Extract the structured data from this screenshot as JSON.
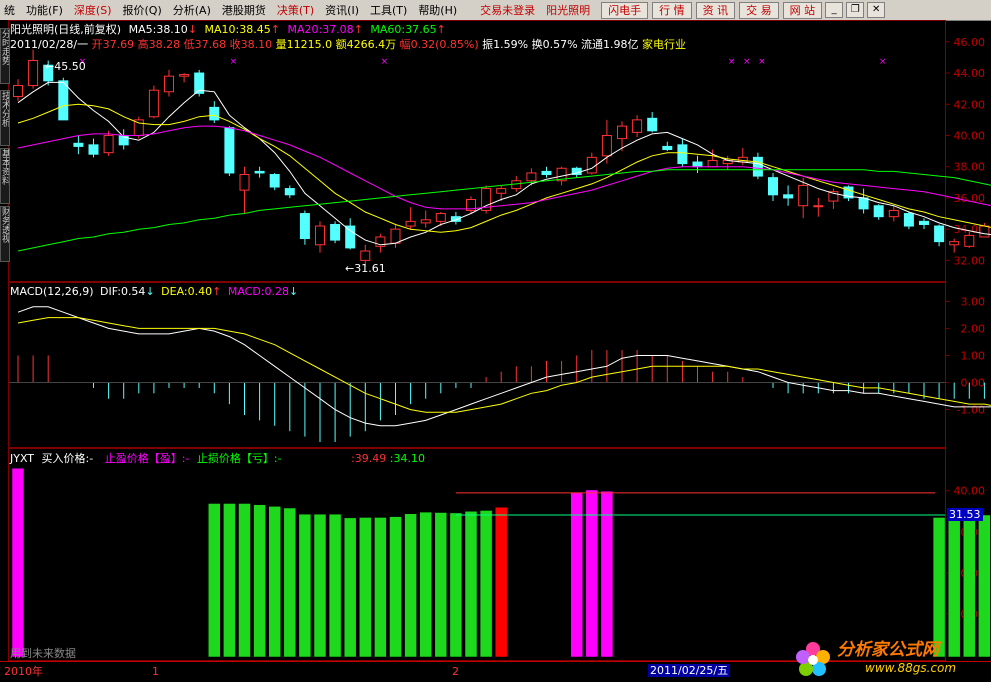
{
  "menu": [
    "统",
    "功能",
    "深度",
    "报价",
    "分析",
    "港股期货",
    "决策",
    "资讯",
    "工具",
    "帮助"
  ],
  "menu_hotkeys": [
    "",
    "(F)",
    "(S)",
    "(Q)",
    "(A)",
    "",
    "(T)",
    "(I)",
    "(T)",
    "(H)"
  ],
  "login_status": "交易未登录",
  "stock_name_menu": "阳光照明",
  "system_buttons": [
    "闪电手",
    "行  情",
    "资  讯",
    "交  易",
    "网  站"
  ],
  "left_tabs": [
    "分时走势",
    "技术分析",
    "基本资料",
    "财务透视"
  ],
  "header": {
    "stock_line": "阳光照明(日线,前复权)",
    "ma5": "MA5:38.10",
    "ma10": "MA10:38.45",
    "ma20": "MA20:37.08",
    "ma60": "MA60:37.65",
    "date": "2011/02/28/一",
    "open": "开37.69",
    "high": "高38.28",
    "low": "低37.68",
    "close": "收38.10",
    "volume": "量11215.0",
    "amount": "额4266.4万",
    "change": "幅0.32(0.85%)",
    "amplitude": "振1.59%",
    "turnover": "换0.57%",
    "float": "流通1.98亿",
    "industry": "家电行业"
  },
  "annotations": {
    "high_mark": "45.50",
    "low_mark": "31.61"
  },
  "macd_header": {
    "name": "MACD(12,26,9)",
    "dif": "DIF:0.54",
    "dea": "DEA:0.40",
    "macd": "MACD:0.28"
  },
  "jyxt_header": {
    "name": "JYXT",
    "buy": "买入价格:-",
    "tp": "止盈价格【盈】:-",
    "sl": "止损价格【亏】:-",
    "v1": ":39.49",
    "v2": ":34.10"
  },
  "jyxt_current": "31.53",
  "jyxt_note": "用到未来数据",
  "time_axis": {
    "year": "2010年",
    "m1": "1",
    "m2": "2",
    "cursor": "2011/02/25/五"
  },
  "logo": {
    "cn": "分析家公式网",
    "url": "www.88gs.com"
  },
  "colors": {
    "up": "#ff3232",
    "down": "#54ffff",
    "ma5": "#ffffff",
    "ma10": "#ffff00",
    "ma20": "#ff00ff",
    "ma60": "#00ff00",
    "grid": "#800000"
  },
  "chart_data": [
    {
      "type": "candlestick",
      "title": "阳光照明(日线,前复权)",
      "ylim": [
        31,
        46.5
      ],
      "yticks": [
        32,
        34,
        36,
        38,
        40,
        42,
        44,
        46
      ],
      "candles": [
        [
          42.5,
          43.6,
          42.2,
          43.2
        ],
        [
          43.2,
          45.5,
          43.0,
          44.8
        ],
        [
          44.5,
          44.8,
          43.2,
          43.5
        ],
        [
          43.5,
          43.7,
          41.0,
          41.0
        ],
        [
          39.5,
          40.0,
          38.8,
          39.3
        ],
        [
          39.4,
          39.8,
          38.6,
          38.8
        ],
        [
          38.9,
          40.3,
          38.7,
          40.0
        ],
        [
          40.0,
          40.4,
          39.1,
          39.4
        ],
        [
          40.0,
          41.2,
          39.8,
          41.0
        ],
        [
          41.2,
          43.2,
          41.1,
          42.9
        ],
        [
          42.8,
          44.2,
          42.5,
          43.8
        ],
        [
          43.8,
          44.0,
          43.4,
          43.9
        ],
        [
          44.0,
          44.2,
          42.5,
          42.7
        ],
        [
          41.8,
          42.2,
          40.8,
          41.0
        ],
        [
          40.5,
          40.6,
          37.4,
          37.6
        ],
        [
          36.5,
          38.0,
          35.0,
          37.5
        ],
        [
          37.7,
          38.0,
          37.3,
          37.6
        ],
        [
          37.5,
          37.6,
          36.5,
          36.7
        ],
        [
          36.6,
          36.8,
          36.0,
          36.2
        ],
        [
          35.0,
          35.2,
          33.0,
          33.4
        ],
        [
          33.0,
          34.5,
          32.5,
          34.2
        ],
        [
          34.3,
          34.5,
          33.1,
          33.3
        ],
        [
          34.2,
          34.7,
          32.7,
          32.8
        ],
        [
          32.0,
          33.0,
          31.6,
          32.6
        ],
        [
          32.9,
          33.7,
          32.5,
          33.5
        ],
        [
          33.1,
          34.3,
          32.8,
          34.0
        ],
        [
          34.2,
          35.4,
          34.0,
          34.5
        ],
        [
          34.4,
          35.2,
          34.1,
          34.6
        ],
        [
          34.5,
          35.1,
          34.2,
          35.0
        ],
        [
          34.8,
          35.1,
          34.3,
          34.5
        ],
        [
          35.2,
          36.1,
          35.0,
          35.9
        ],
        [
          35.2,
          36.8,
          35.0,
          36.6
        ],
        [
          36.3,
          36.8,
          35.8,
          36.6
        ],
        [
          36.6,
          37.4,
          36.4,
          37.1
        ],
        [
          37.1,
          37.9,
          36.8,
          37.6
        ],
        [
          37.7,
          38.0,
          37.3,
          37.5
        ],
        [
          37.1,
          38.0,
          36.8,
          37.9
        ],
        [
          37.9,
          38.0,
          37.3,
          37.5
        ],
        [
          37.6,
          38.9,
          37.5,
          38.6
        ],
        [
          38.7,
          41.0,
          38.2,
          40.0
        ],
        [
          39.8,
          40.9,
          39.0,
          40.6
        ],
        [
          40.2,
          41.3,
          39.9,
          41.0
        ],
        [
          41.1,
          41.5,
          40.2,
          40.3
        ],
        [
          39.3,
          39.6,
          39.0,
          39.1
        ],
        [
          39.4,
          39.8,
          38.0,
          38.2
        ],
        [
          38.3,
          38.7,
          37.6,
          38.0
        ],
        [
          38.0,
          39.1,
          38.0,
          38.4
        ],
        [
          38.2,
          38.7,
          37.8,
          38.4
        ],
        [
          38.3,
          39.2,
          38.1,
          38.6
        ],
        [
          38.6,
          38.9,
          37.2,
          37.4
        ],
        [
          37.3,
          37.6,
          35.8,
          36.2
        ],
        [
          36.2,
          36.8,
          35.5,
          36.0
        ],
        [
          35.5,
          37.3,
          34.7,
          36.8
        ],
        [
          35.5,
          36.0,
          34.8,
          35.5
        ],
        [
          35.8,
          36.6,
          35.3,
          36.4
        ],
        [
          36.7,
          36.8,
          35.8,
          36.0
        ],
        [
          36.0,
          36.6,
          35.0,
          35.3
        ],
        [
          35.5,
          35.6,
          34.6,
          34.8
        ],
        [
          34.8,
          35.5,
          34.5,
          35.2
        ],
        [
          35.0,
          35.1,
          34.0,
          34.2
        ],
        [
          34.5,
          34.7,
          34.0,
          34.3
        ],
        [
          34.2,
          34.3,
          32.9,
          33.2
        ],
        [
          33.0,
          33.4,
          32.5,
          33.2
        ],
        [
          32.9,
          33.8,
          32.8,
          33.6
        ],
        [
          33.5,
          34.4,
          33.5,
          34.2
        ],
        [
          34.1,
          34.4,
          33.3,
          33.4
        ]
      ],
      "ma_series": [
        {
          "name": "MA5",
          "values": [
            42.1,
            42.8,
            43.4,
            43.4,
            42.4,
            41.6,
            40.9,
            39.9,
            39.7,
            40.2,
            41.2,
            42.1,
            42.9,
            42.8,
            41.3,
            40.5,
            39.8,
            38.9,
            37.7,
            36.3,
            35.5,
            34.7,
            33.9,
            33.3,
            33.0,
            33.1,
            33.5,
            33.8,
            34.3,
            34.6,
            35.0,
            35.5,
            35.9,
            36.2,
            36.9,
            37.2,
            37.4,
            37.6,
            37.9,
            38.6,
            39.2,
            39.7,
            40.1,
            40.2,
            39.8,
            39.4,
            38.8,
            38.4,
            38.3,
            38.2,
            37.8,
            37.4,
            37.0,
            36.6,
            36.3,
            36.1,
            36.0,
            35.7,
            35.5,
            35.1,
            34.8,
            34.4,
            34.1,
            33.9,
            33.7,
            33.6
          ]
        },
        {
          "name": "MA10",
          "values": [
            40.8,
            41.1,
            41.5,
            41.9,
            42.0,
            41.9,
            41.7,
            41.2,
            40.8,
            40.7,
            40.7,
            40.9,
            41.2,
            41.3,
            40.9,
            40.4,
            39.8,
            39.3,
            38.7,
            37.9,
            37.1,
            36.3,
            35.7,
            35.1,
            34.7,
            34.3,
            34.0,
            33.9,
            33.8,
            33.9,
            34.1,
            34.5,
            34.9,
            35.2,
            35.6,
            36.0,
            36.3,
            36.6,
            36.9,
            37.3,
            37.8,
            38.3,
            38.7,
            38.9,
            38.9,
            38.8,
            38.7,
            38.5,
            38.4,
            38.3,
            38.0,
            37.7,
            37.4,
            37.1,
            36.8,
            36.5,
            36.2,
            35.9,
            35.6,
            35.3,
            35.1,
            34.8,
            34.6,
            34.4,
            34.2,
            34.0
          ]
        },
        {
          "name": "MA20",
          "values": [
            39.2,
            39.4,
            39.6,
            39.8,
            40.0,
            40.1,
            40.1,
            40.0,
            40.0,
            40.1,
            40.3,
            40.5,
            40.6,
            40.6,
            40.5,
            40.3,
            40.0,
            39.7,
            39.4,
            39.0,
            38.6,
            38.1,
            37.6,
            37.1,
            36.6,
            36.1,
            35.7,
            35.4,
            35.3,
            35.3,
            35.3,
            35.4,
            35.5,
            35.6,
            35.7,
            35.9,
            36.1,
            36.3,
            36.5,
            36.8,
            37.1,
            37.4,
            37.7,
            37.9,
            38.0,
            38.0,
            38.0,
            38.0,
            38.0,
            37.9,
            37.8,
            37.6,
            37.4,
            37.2,
            37.0,
            36.9,
            36.8,
            36.7,
            36.6,
            36.5,
            36.4,
            36.2,
            36.0,
            35.8,
            35.6,
            35.4
          ]
        },
        {
          "name": "MA60",
          "values": [
            32.6,
            32.8,
            33.0,
            33.2,
            33.4,
            33.5,
            33.7,
            33.8,
            34.0,
            34.1,
            34.3,
            34.4,
            34.6,
            34.7,
            34.9,
            35.0,
            35.2,
            35.3,
            35.4,
            35.5,
            35.6,
            35.7,
            35.8,
            35.9,
            36.0,
            36.1,
            36.2,
            36.3,
            36.4,
            36.5,
            36.6,
            36.7,
            36.8,
            36.9,
            37.0,
            37.1,
            37.2,
            37.3,
            37.4,
            37.5,
            37.6,
            37.7,
            37.7,
            37.8,
            37.8,
            37.8,
            37.8,
            37.8,
            37.8,
            37.8,
            37.8,
            37.8,
            37.8,
            37.8,
            37.8,
            37.8,
            37.8,
            37.7,
            37.7,
            37.6,
            37.5,
            37.4,
            37.3,
            37.1,
            36.9,
            36.7
          ]
        }
      ]
    },
    {
      "type": "bar",
      "title": "MACD(12,26,9)",
      "ylim": [
        -2.2,
        3.2
      ],
      "yticks": [
        -1.0,
        0.0,
        1.0,
        2.0,
        3.0
      ],
      "values": [
        1.0,
        1.0,
        1.0,
        0.0,
        0.0,
        -0.2,
        -0.6,
        -0.6,
        -0.4,
        -0.4,
        -0.2,
        -0.2,
        -0.2,
        -0.4,
        -0.8,
        -1.2,
        -1.4,
        -1.6,
        -1.8,
        -2.0,
        -2.2,
        -2.2,
        -2.0,
        -1.8,
        -1.4,
        -1.2,
        -0.8,
        -0.6,
        -0.4,
        -0.2,
        -0.2,
        0.2,
        0.4,
        0.6,
        0.6,
        0.8,
        0.8,
        1.0,
        1.2,
        1.2,
        1.2,
        1.2,
        1.0,
        1.0,
        0.8,
        0.6,
        0.4,
        0.4,
        0.2,
        0.0,
        -0.2,
        -0.4,
        -0.4,
        -0.4,
        -0.4,
        -0.4,
        -0.4,
        -0.4,
        -0.4,
        -0.4,
        -0.6,
        -0.6,
        -0.6,
        -0.6,
        -0.6,
        -0.6
      ],
      "series": [
        {
          "name": "DIF",
          "values": [
            2.6,
            2.8,
            2.8,
            2.6,
            2.4,
            2.2,
            2.0,
            1.9,
            1.8,
            1.8,
            1.8,
            1.9,
            2.0,
            1.9,
            1.7,
            1.4,
            1.0,
            0.6,
            0.2,
            -0.2,
            -0.6,
            -1.0,
            -1.3,
            -1.5,
            -1.6,
            -1.6,
            -1.5,
            -1.4,
            -1.2,
            -1.0,
            -0.8,
            -0.6,
            -0.4,
            -0.2,
            0.0,
            0.2,
            0.3,
            0.4,
            0.5,
            0.6,
            0.9,
            1.0,
            1.0,
            1.0,
            0.9,
            0.8,
            0.7,
            0.6,
            0.5,
            0.4,
            0.2,
            0.0,
            -0.1,
            -0.2,
            -0.3,
            -0.3,
            -0.4,
            -0.4,
            -0.5,
            -0.6,
            -0.7,
            -0.8,
            -0.9,
            -0.9,
            -0.9,
            -0.9
          ]
        },
        {
          "name": "DEA",
          "values": [
            2.2,
            2.3,
            2.4,
            2.4,
            2.4,
            2.3,
            2.2,
            2.1,
            2.0,
            2.0,
            2.0,
            2.0,
            2.0,
            2.0,
            1.9,
            1.8,
            1.6,
            1.4,
            1.1,
            0.8,
            0.5,
            0.2,
            -0.1,
            -0.4,
            -0.6,
            -0.8,
            -1.0,
            -1.1,
            -1.1,
            -1.1,
            -1.0,
            -0.9,
            -0.8,
            -0.6,
            -0.4,
            -0.3,
            -0.1,
            0.0,
            0.2,
            0.3,
            0.4,
            0.5,
            0.6,
            0.6,
            0.6,
            0.6,
            0.6,
            0.6,
            0.5,
            0.5,
            0.4,
            0.3,
            0.2,
            0.1,
            0.0,
            -0.1,
            -0.2,
            -0.2,
            -0.3,
            -0.4,
            -0.5,
            -0.6,
            -0.7,
            -0.8,
            -0.8,
            -0.9
          ]
        }
      ]
    },
    {
      "type": "bar",
      "title": "JYXT",
      "ylim": [
        0,
        47
      ],
      "yticks": [
        10,
        20,
        30,
        40
      ],
      "values": [
        45.5,
        null,
        null,
        null,
        null,
        null,
        null,
        null,
        null,
        null,
        null,
        null,
        null,
        36.9,
        36.9,
        36.9,
        36.6,
        36.2,
        35.8,
        34.3,
        34.3,
        34.3,
        33.4,
        33.5,
        33.5,
        33.7,
        34.4,
        34.8,
        34.7,
        34.6,
        35.0,
        35.2,
        36.0,
        null,
        null,
        null,
        null,
        null,
        null,
        null,
        null,
        null,
        null,
        null,
        null,
        null,
        null,
        null,
        null,
        null,
        null,
        null,
        null,
        null,
        null,
        null,
        null,
        null,
        null,
        null,
        null,
        33.5,
        33.6,
        33.7,
        34.1,
        34.2
      ],
      "colors_by_index": {
        "0": "#ff00ff",
        "37": "#ff00ff",
        "38": "#ff00ff",
        "39": "#ff00ff",
        "32": "#ff0000"
      },
      "magenta_values": {
        "37": 39.6,
        "38": 40.2,
        "39": 39.9
      },
      "hlines": [
        39.49,
        34.1
      ]
    }
  ]
}
